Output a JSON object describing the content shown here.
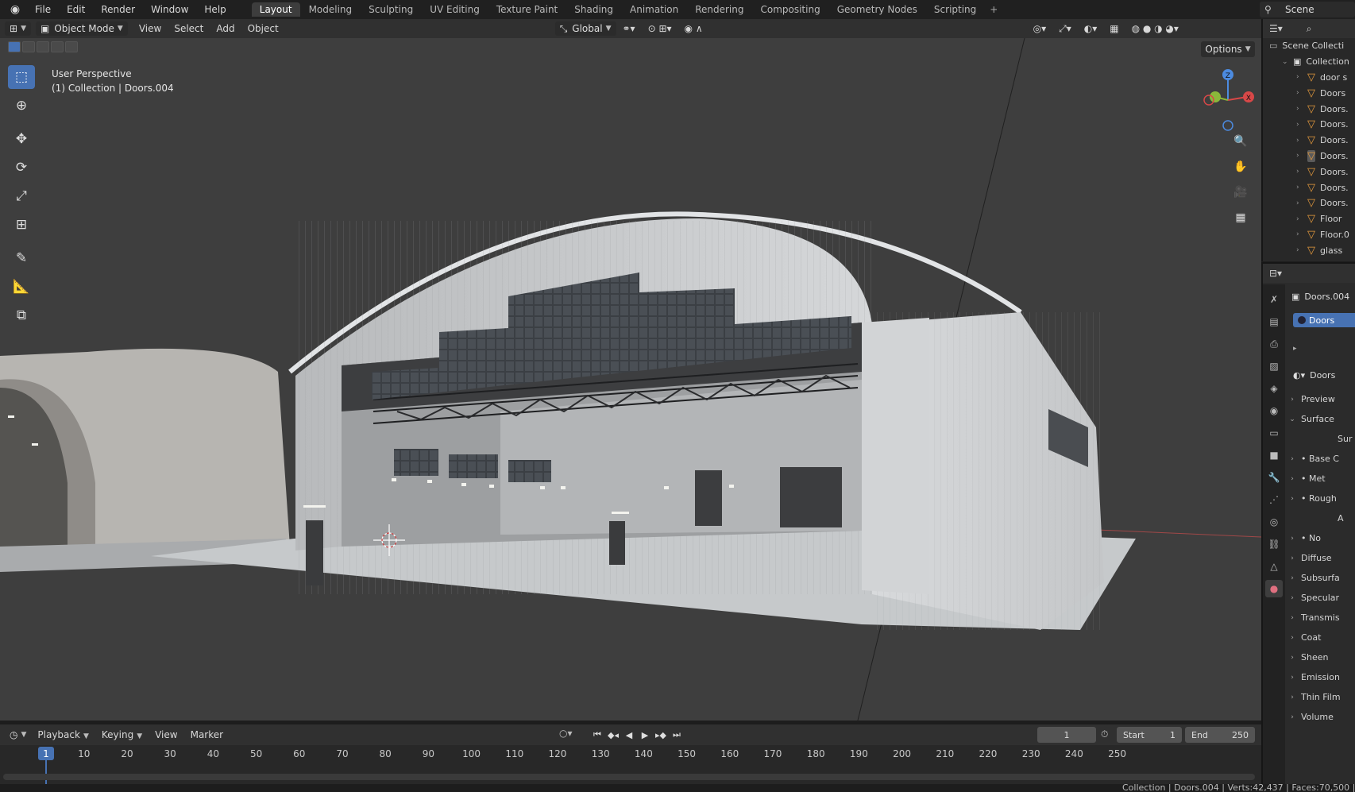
{
  "topbar": {
    "menu": [
      "File",
      "Edit",
      "Render",
      "Window",
      "Help"
    ],
    "workspaces": [
      "Layout",
      "Modeling",
      "Sculpting",
      "UV Editing",
      "Texture Paint",
      "Shading",
      "Animation",
      "Rendering",
      "Compositing",
      "Geometry Nodes",
      "Scripting"
    ],
    "active_workspace": "Layout",
    "scene": "Scene"
  },
  "viewport_header": {
    "mode": "Object Mode",
    "menus": [
      "View",
      "Select",
      "Add",
      "Object"
    ],
    "orientation": "Global"
  },
  "viewport": {
    "view_name": "User Perspective",
    "collection_info": "(1) Collection | Doors.004",
    "options_label": "Options",
    "gizmo_labels": {
      "z": "Z",
      "x": "X"
    }
  },
  "outliner": {
    "root": "Scene Collecti",
    "collection": "Collection",
    "items": [
      "door s",
      "Doors",
      "Doors.",
      "Doors.",
      "Doors.",
      "Doors.",
      "Doors.",
      "Doors.",
      "Doors.",
      "Floor",
      "Floor.0",
      "glass"
    ]
  },
  "properties": {
    "object_name": "Doors.004",
    "material_slot": "Doors",
    "material_name": "Doors",
    "rows": [
      {
        "label": "Preview",
        "arrow": "›"
      },
      {
        "label": "Surface",
        "arrow": "⌄"
      },
      {
        "label": "Sur",
        "arrow": ""
      },
      {
        "label": "• Base C",
        "arrow": "›"
      },
      {
        "label": "• Met",
        "arrow": "›"
      },
      {
        "label": "• Rough",
        "arrow": "›"
      },
      {
        "label": "A",
        "arrow": ""
      },
      {
        "label": "• No",
        "arrow": "›"
      },
      {
        "label": "Diffuse",
        "arrow": "›"
      },
      {
        "label": "Subsurfa",
        "arrow": "›"
      },
      {
        "label": "Specular",
        "arrow": "›"
      },
      {
        "label": "Transmis",
        "arrow": "›"
      },
      {
        "label": "Coat",
        "arrow": "›"
      },
      {
        "label": "Sheen",
        "arrow": "›"
      },
      {
        "label": "Emission",
        "arrow": "›"
      },
      {
        "label": "Thin Film",
        "arrow": "›"
      },
      {
        "label": "Volume",
        "arrow": "›"
      }
    ]
  },
  "timeline": {
    "menus": [
      "Playback",
      "Keying",
      "View",
      "Marker"
    ],
    "current_frame": "1",
    "start_label": "Start",
    "start": "1",
    "end_label": "End",
    "end": "250",
    "playhead": "1",
    "ticks": [
      "10",
      "20",
      "30",
      "40",
      "50",
      "60",
      "70",
      "80",
      "90",
      "100",
      "110",
      "120",
      "130",
      "140",
      "150",
      "160",
      "170",
      "180",
      "190",
      "200",
      "210",
      "220",
      "230",
      "240",
      "250"
    ]
  },
  "status": "Collection | Doors.004 | Verts:42,437 | Faces:70,500 | T"
}
